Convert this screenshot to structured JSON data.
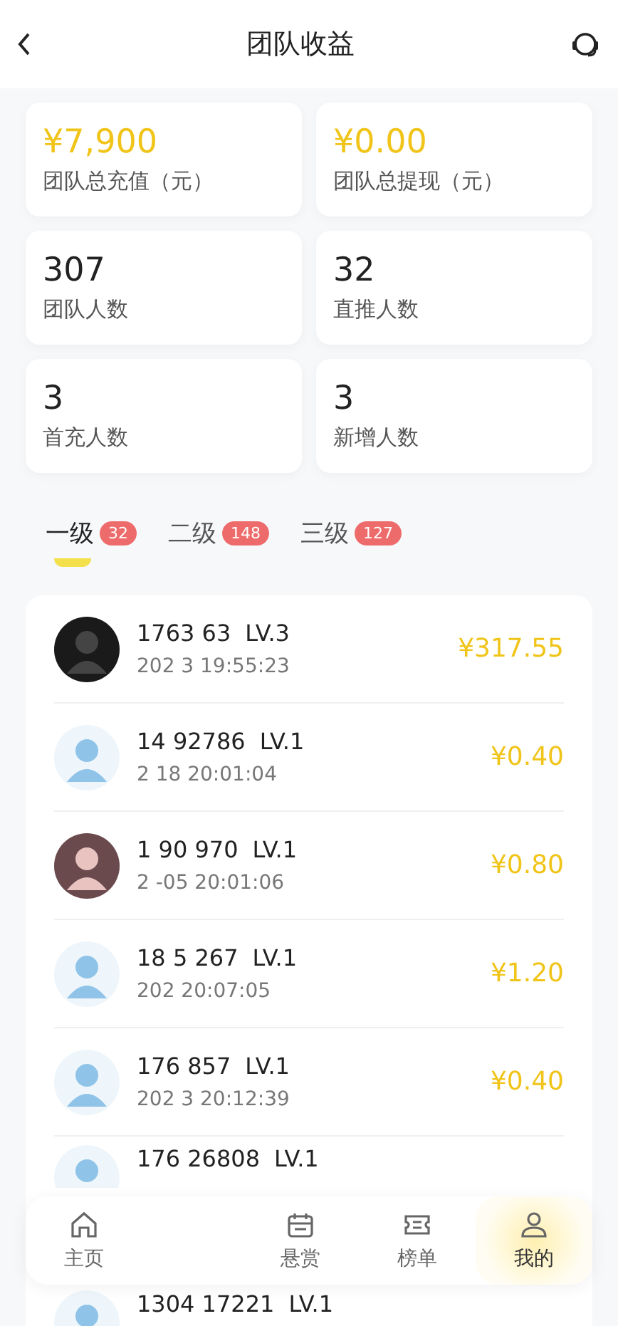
{
  "header": {
    "title": "团队收益"
  },
  "stats": [
    {
      "value": "¥7,900",
      "label": "团队总充值（元）",
      "kind": "money"
    },
    {
      "value": "¥0.00",
      "label": "团队总提现（元）",
      "kind": "money"
    },
    {
      "value": "307",
      "label": "团队人数",
      "kind": "count"
    },
    {
      "value": "32",
      "label": "直推人数",
      "kind": "count"
    },
    {
      "value": "3",
      "label": "首充人数",
      "kind": "count"
    },
    {
      "value": "3",
      "label": "新增人数",
      "kind": "count"
    }
  ],
  "tabs": [
    {
      "label": "一级",
      "count": "32",
      "selected": true
    },
    {
      "label": "二级",
      "count": "148",
      "selected": false
    },
    {
      "label": "三级",
      "count": "127",
      "selected": false
    }
  ],
  "members": [
    {
      "name": "1763 63",
      "level": "LV.3",
      "time": "202 3 19:55:23",
      "amount": "¥317.55"
    },
    {
      "name": "14 92786",
      "level": "LV.1",
      "time": "2 18 20:01:04",
      "amount": "¥0.40"
    },
    {
      "name": "1 90 970",
      "level": "LV.1",
      "time": "2 -05 20:01:06",
      "amount": "¥0.80"
    },
    {
      "name": "18 5 267",
      "level": "LV.1",
      "time": "202 20:07:05",
      "amount": "¥1.20"
    },
    {
      "name": "176 857",
      "level": "LV.1",
      "time": "202 3 20:12:39",
      "amount": "¥0.40"
    },
    {
      "name": "176 26808",
      "level": "LV.1"
    },
    {
      "name": "1304 17221",
      "level": "LV.1"
    }
  ],
  "bottom_nav": [
    {
      "kind": "home",
      "label": "主页",
      "selected": false
    },
    {
      "kind": "hidden"
    },
    {
      "kind": "calendar",
      "label": "悬赏",
      "selected": false
    },
    {
      "kind": "ticket",
      "label": "榜单",
      "selected": false
    },
    {
      "kind": "person",
      "label": "我的",
      "selected": true
    }
  ]
}
